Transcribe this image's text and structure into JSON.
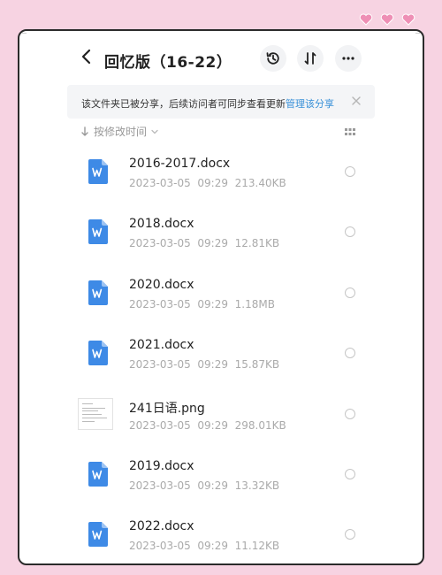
{
  "header": {
    "title": "回忆版（16-22）"
  },
  "banner": {
    "text": "该文件夹已被分享，后续访问者可同步查看更新",
    "link": "管理该分享"
  },
  "sort": {
    "label": "按修改时间"
  },
  "files": [
    {
      "name": "2016-2017.docx",
      "date": "2023-03-05",
      "time": "09:29",
      "size": "213.40KB",
      "type": "word"
    },
    {
      "name": "2018.docx",
      "date": "2023-03-05",
      "time": "09:29",
      "size": "12.81KB",
      "type": "word"
    },
    {
      "name": "2020.docx",
      "date": "2023-03-05",
      "time": "09:29",
      "size": "1.18MB",
      "type": "word"
    },
    {
      "name": "2021.docx",
      "date": "2023-03-05",
      "time": "09:29",
      "size": "15.87KB",
      "type": "word"
    },
    {
      "name": "241日语.png",
      "date": "2023-03-05",
      "time": "09:29",
      "size": "298.01KB",
      "type": "image"
    },
    {
      "name": "2019.docx",
      "date": "2023-03-05",
      "time": "09:29",
      "size": "13.32KB",
      "type": "word"
    },
    {
      "name": "2022.docx",
      "date": "2023-03-05",
      "time": "09:29",
      "size": "11.12KB",
      "type": "word"
    }
  ],
  "colors": {
    "background": "#f7d3e2",
    "word_icon": "#3e8ae6",
    "link": "#3790d8",
    "heart": "#ee8fb5"
  }
}
